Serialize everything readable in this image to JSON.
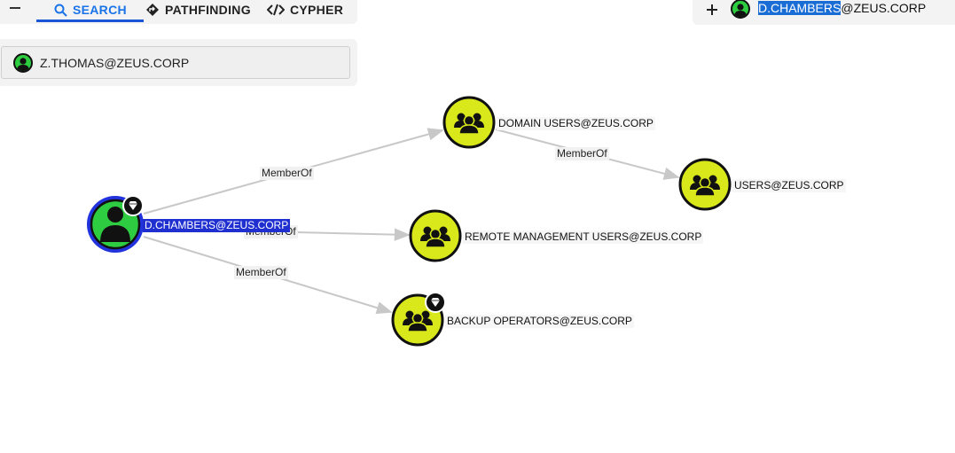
{
  "tabs": [
    {
      "label": "SEARCH",
      "icon": "search-icon",
      "active": true
    },
    {
      "label": "PATHFINDING",
      "icon": "diamond-arrow-icon"
    },
    {
      "label": "CYPHER",
      "icon": "code-icon"
    }
  ],
  "search": {
    "value": "Z.THOMAS@ZEUS.CORP"
  },
  "detail": {
    "name_selected": "D.CHAMBERS",
    "name_rest": "@ZEUS.CORP"
  },
  "graph": {
    "nodes": [
      {
        "id": "dchambers",
        "label": "D.CHAMBERS@ZEUS.CORP",
        "type": "user",
        "selected": true,
        "high_value": true
      },
      {
        "id": "domainusers",
        "label": "DOMAIN USERS@ZEUS.CORP",
        "type": "group"
      },
      {
        "id": "users",
        "label": "USERS@ZEUS.CORP",
        "type": "group"
      },
      {
        "id": "remotemgmt",
        "label": "REMOTE MANAGEMENT USERS@ZEUS.CORP",
        "type": "group"
      },
      {
        "id": "backupops",
        "label": "BACKUP OPERATORS@ZEUS.CORP",
        "type": "group",
        "high_value": true
      }
    ],
    "edges": [
      {
        "from": "dchambers",
        "to": "domainusers",
        "label": "MemberOf"
      },
      {
        "from": "dchambers",
        "to": "remotemgmt",
        "label": "MemberOf"
      },
      {
        "from": "dchambers",
        "to": "backupops",
        "label": "MemberOf"
      },
      {
        "from": "domainusers",
        "to": "users",
        "label": "MemberOf"
      }
    ]
  },
  "colors": {
    "accent": "#1a73e8",
    "user_node": "#2ecc40",
    "group_node": "#d8e81a",
    "selected_ring": "#2233dd",
    "edge": "#c8c8c8"
  }
}
